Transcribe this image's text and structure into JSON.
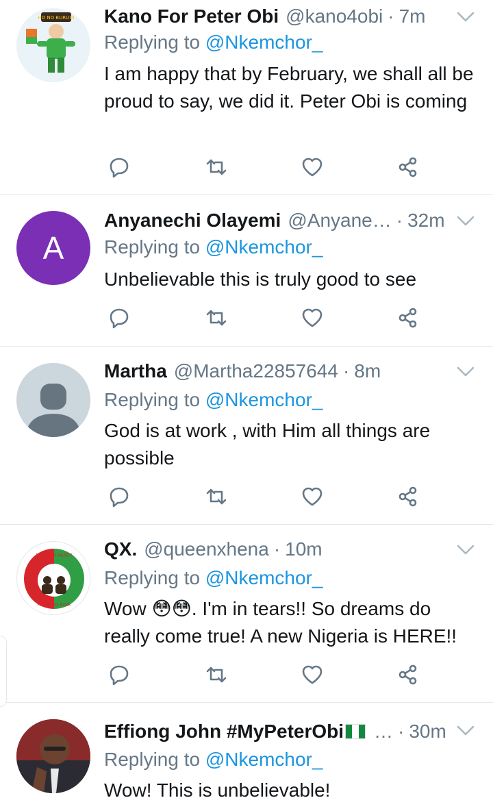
{
  "tweets": [
    {
      "name": "Kano For Peter Obi",
      "handle": "@kano4obi",
      "time": "7m",
      "replying_label": "Replying to",
      "replying_to": "@Nkemchor_",
      "text": "I am happy that by February, we shall all be proud to say, we did it. Peter Obi is coming",
      "avatar_text": "HO NO BURUDI"
    },
    {
      "name": "Anyanechi Olayemi",
      "handle": "@Anyane…",
      "time": "32m",
      "replying_label": "Replying to",
      "replying_to": "@Nkemchor_",
      "text": "Unbelievable this is truly good to see",
      "avatar_letter": "A",
      "avatar_color": "#7b2fb5"
    },
    {
      "name": "Martha",
      "handle": "@Martha22857644",
      "time": "8m",
      "replying_label": "Replying to",
      "replying_to": "@Nkemchor_",
      "text": "God is at work , with Him all things are possible"
    },
    {
      "name": "QX.",
      "handle": "@queenxhena",
      "time": "10m",
      "replying_label": "Replying to",
      "replying_to": "@Nkemchor_",
      "text": "Wow 😳😳. I'm in tears!! So dreams do really come true! A new Nigeria is HERE!!",
      "avatar_text_top": "LABOUR PARTY",
      "avatar_text_bottom": "FORWARD EVER"
    },
    {
      "name": "Effiong John #MyPeterObi",
      "handle": "…",
      "time": "30m",
      "replying_label": "Replying to",
      "replying_to": "@Nkemchor_",
      "text": "Wow! This is unbelievable!"
    }
  ],
  "icons": {
    "reply": "reply-icon",
    "retweet": "retweet-icon",
    "like": "heart-icon",
    "share": "share-icon",
    "menu": "chevron-down-icon"
  },
  "colors": {
    "name": "#14171a",
    "muted": "#657786",
    "mention": "#1b95e0",
    "divider": "#e1e8ed"
  }
}
